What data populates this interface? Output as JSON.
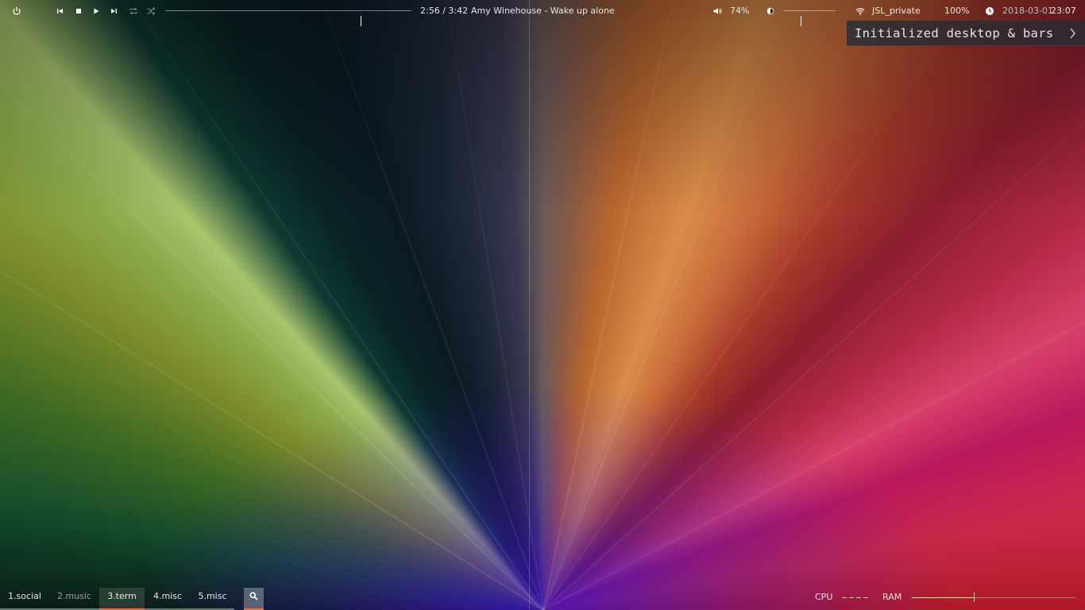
{
  "topbar": {
    "media": {
      "elapsed_total": "2:56 / 3:42",
      "track": "Amy Winehouse - Wake up alone",
      "progress": 0.793
    },
    "volume": {
      "label": "74%"
    },
    "brightness": {
      "level": 0.33
    },
    "wifi": {
      "ssid": "JSL_private"
    },
    "battery": {
      "label": "100%"
    },
    "clock": {
      "date": "2018-03-01",
      "time": "23:07"
    }
  },
  "notification": {
    "text": "Initialized desktop & bars"
  },
  "bottombar": {
    "workspaces": [
      {
        "label": "1.social"
      },
      {
        "label": "2.music"
      },
      {
        "label": "3.term"
      },
      {
        "label": "4.misc"
      },
      {
        "label": "5.misc"
      }
    ],
    "cpu": {
      "label": "CPU"
    },
    "ram": {
      "label": "RAM",
      "level": 0.38
    }
  },
  "colors": {
    "accent": "#e0704a",
    "workspace_underline": "#6a7a6a",
    "ram": "#e8d59a"
  }
}
